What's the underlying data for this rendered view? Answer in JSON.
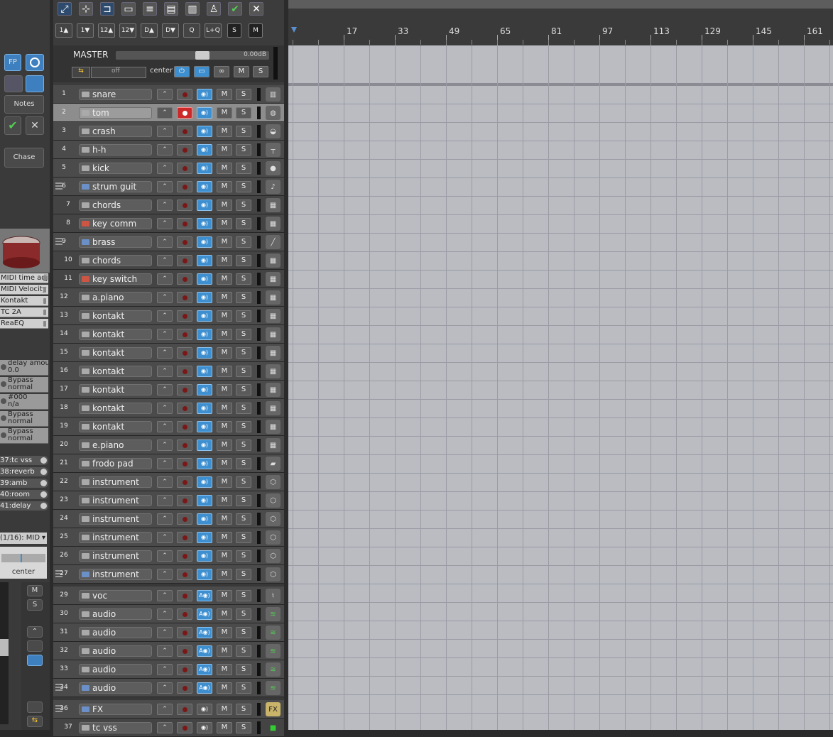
{
  "toolbar": {
    "row2": [
      "1▲",
      "1▼",
      "12▲",
      "12▼",
      "D▲",
      "D▼",
      "Q",
      "L+Q",
      "S",
      "M"
    ]
  },
  "master": {
    "label": "MASTER",
    "volume": "0.00dB",
    "automation": "off",
    "pan": "center",
    "mute": "M",
    "solo": "S"
  },
  "inspector": {
    "fp_label": "FP",
    "notes_label": "Notes",
    "chase_label": "Chase",
    "fx_chain": [
      "MIDI time adjus",
      "MIDI Velocity a",
      "Kontakt",
      "TC 2A",
      "ReaEQ"
    ],
    "params": [
      {
        "name": "delay amount",
        "value": "0.0"
      },
      {
        "name": "Bypass",
        "value": "normal"
      },
      {
        "name": "#000",
        "value": "n/a"
      },
      {
        "name": "Bypass",
        "value": "normal"
      },
      {
        "name": "Bypass",
        "value": "normal"
      }
    ],
    "sends": [
      "37:tc vss",
      "38:reverb",
      "39:amb",
      "40:room",
      "41:delay"
    ],
    "midi_input": "(1/16): MID",
    "pan_label": "center",
    "mute": "M",
    "solo": "S"
  },
  "tracks": [
    {
      "num": "1",
      "name": "snare",
      "icon": "snare-drum-icon",
      "level": 0
    },
    {
      "num": "2",
      "name": "tom",
      "icon": "tom-drum-icon",
      "level": 0,
      "armed": true,
      "selected": true
    },
    {
      "num": "3",
      "name": "crash",
      "icon": "cymbal-icon",
      "level": 0
    },
    {
      "num": "4",
      "name": "h-h",
      "icon": "hihat-icon",
      "level": 0
    },
    {
      "num": "5",
      "name": "kick",
      "icon": "kick-drum-icon",
      "level": 0
    },
    {
      "num": "6",
      "name": "strum guit",
      "icon": "guitar-icon",
      "level": 0,
      "folder": true
    },
    {
      "num": "7",
      "name": "chords",
      "icon": "keyboard-icon",
      "level": 1
    },
    {
      "num": "8",
      "name": "key comm",
      "icon": "keyboard-icon",
      "level": 1,
      "midi": true
    },
    {
      "num": "9",
      "name": "brass",
      "icon": "trumpet-icon",
      "level": 0,
      "folder": true
    },
    {
      "num": "10",
      "name": "chords",
      "icon": "keyboard-icon",
      "level": 1
    },
    {
      "num": "11",
      "name": "key switch",
      "icon": "keyboard-icon",
      "level": 1,
      "midi": true
    },
    {
      "num": "12",
      "name": "a.piano",
      "icon": "keyboard-icon",
      "level": 0
    },
    {
      "num": "13",
      "name": "kontakt",
      "icon": "keyboard-icon",
      "level": 0
    },
    {
      "num": "14",
      "name": "kontakt",
      "icon": "keyboard-icon",
      "level": 0
    },
    {
      "num": "15",
      "name": "kontakt",
      "icon": "keyboard-icon",
      "level": 0
    },
    {
      "num": "16",
      "name": "kontakt",
      "icon": "keyboard-icon",
      "level": 0
    },
    {
      "num": "17",
      "name": "kontakt",
      "icon": "keyboard-icon",
      "level": 0
    },
    {
      "num": "18",
      "name": "kontakt",
      "icon": "keyboard-icon",
      "level": 0
    },
    {
      "num": "19",
      "name": "kontakt",
      "icon": "keyboard-icon",
      "level": 0
    },
    {
      "num": "20",
      "name": "e.piano",
      "icon": "keyboard-icon",
      "level": 0
    },
    {
      "num": "21",
      "name": "frodo pad",
      "icon": "synth-icon",
      "level": 0
    },
    {
      "num": "22",
      "name": "instrument",
      "icon": "shield-icon",
      "level": 0
    },
    {
      "num": "23",
      "name": "instrument",
      "icon": "shield-icon",
      "level": 0
    },
    {
      "num": "24",
      "name": "instrument",
      "icon": "shield-icon",
      "level": 0
    },
    {
      "num": "25",
      "name": "instrument",
      "icon": "shield-icon",
      "level": 0
    },
    {
      "num": "26",
      "name": "instrument",
      "icon": "shield-icon",
      "level": 0
    },
    {
      "num": "27",
      "name": "instrument",
      "icon": "shield-icon",
      "level": 0,
      "folder": true,
      "gap_after": true
    },
    {
      "num": "29",
      "name": "voc",
      "icon": "microphone-icon",
      "level": 0,
      "audio": true
    },
    {
      "num": "30",
      "name": "audio",
      "icon": "waveform-icon",
      "level": 0,
      "audio": true
    },
    {
      "num": "31",
      "name": "audio",
      "icon": "waveform-icon",
      "level": 0,
      "audio": true
    },
    {
      "num": "32",
      "name": "audio",
      "icon": "waveform-icon",
      "level": 0,
      "audio": true
    },
    {
      "num": "33",
      "name": "audio",
      "icon": "waveform-icon",
      "level": 0,
      "audio": true
    },
    {
      "num": "34",
      "name": "audio",
      "icon": "waveform-icon",
      "level": 0,
      "audio": true,
      "folder": true,
      "gap_after": true
    },
    {
      "num": "36",
      "name": "FX",
      "icon": "fx-icon",
      "level": 0,
      "folder": true,
      "mon_off": true
    },
    {
      "num": "37",
      "name": "tc vss",
      "icon": "green-square-icon",
      "level": 1,
      "mon_off": true
    }
  ],
  "track_buttons": {
    "mute": "M",
    "solo": "S",
    "env": "⌃"
  },
  "ruler": {
    "bars": [
      "17",
      "33",
      "49",
      "65",
      "81",
      "97",
      "113",
      "129",
      "145",
      "161"
    ]
  },
  "colors": {
    "accent_blue": "#3d8fd0",
    "record_red": "#cc2a2a",
    "arrange_bg": "#babcc2"
  }
}
